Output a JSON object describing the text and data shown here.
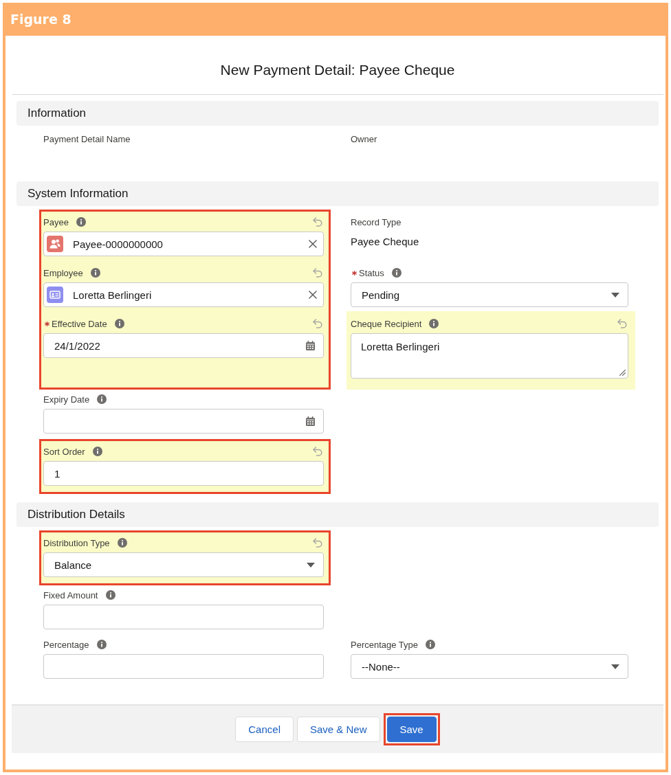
{
  "figure": {
    "label": "Figure 8"
  },
  "modal": {
    "title": "New Payment Detail: Payee Cheque"
  },
  "sections": [
    {
      "title": "Information",
      "groups": [
        {
          "outlined": false,
          "rows": [
            {
              "left": {
                "kind": "readonly",
                "label": "Payment Detail Name",
                "required": false,
                "help": false,
                "changed": false
              },
              "right": {
                "kind": "readonly",
                "label": "Owner",
                "required": false,
                "help": false,
                "changed": false
              }
            }
          ]
        }
      ]
    },
    {
      "title": "System Information",
      "groups": [
        {
          "outlined": true,
          "rows": [
            {
              "left": {
                "kind": "lookup",
                "label": "Payee",
                "required": false,
                "help": true,
                "changed": true,
                "value": "Payee-0000000000",
                "color": "#e4756c"
              },
              "right": {
                "kind": "readonly",
                "label": "Record Type",
                "required": false,
                "help": false,
                "changed": false,
                "value": "Payee Cheque"
              }
            },
            {
              "left": {
                "kind": "lookup",
                "label": "Employee",
                "required": false,
                "help": true,
                "changed": true,
                "value": "Loretta Berlingeri",
                "color": "#8f8ef0"
              },
              "right": {
                "kind": "picklist",
                "label": "Status",
                "required": true,
                "help": true,
                "changed": false,
                "value": "Pending"
              }
            },
            {
              "left": {
                "kind": "date",
                "label": "Effective Date",
                "required": true,
                "help": true,
                "changed": true,
                "value": "24/1/2022"
              },
              "right": {
                "kind": "textarea",
                "label": "Cheque Recipient",
                "required": false,
                "help": true,
                "changed": true,
                "value": "Loretta Berlingeri"
              }
            }
          ]
        },
        {
          "outlined": false,
          "rows": [
            {
              "left": {
                "kind": "date",
                "label": "Expiry Date",
                "required": false,
                "help": true,
                "changed": false
              }
            }
          ]
        },
        {
          "outlined": true,
          "rows": [
            {
              "left": {
                "kind": "text",
                "label": "Sort Order",
                "required": false,
                "help": true,
                "changed": true,
                "value": "1"
              }
            }
          ]
        }
      ]
    },
    {
      "title": "Distribution Details",
      "groups": [
        {
          "outlined": true,
          "rows": [
            {
              "left": {
                "kind": "picklist",
                "label": "Distribution Type",
                "required": false,
                "help": true,
                "changed": true,
                "value": "Balance"
              }
            }
          ]
        },
        {
          "outlined": false,
          "rows": [
            {
              "left": {
                "kind": "text",
                "label": "Fixed Amount",
                "required": false,
                "help": true,
                "changed": false
              }
            },
            {
              "left": {
                "kind": "text",
                "label": "Percentage",
                "required": false,
                "help": true,
                "changed": false
              },
              "right": {
                "kind": "picklist",
                "label": "Percentage Type",
                "required": false,
                "help": true,
                "changed": false,
                "value": "--None--"
              }
            }
          ]
        }
      ]
    }
  ],
  "footer": {
    "buttons": [
      {
        "label": "Cancel",
        "kind": "neutral",
        "outlined": false
      },
      {
        "label": "Save & New",
        "kind": "neutral",
        "outlined": false
      },
      {
        "label": "Save",
        "kind": "brand",
        "outlined": true
      }
    ]
  }
}
